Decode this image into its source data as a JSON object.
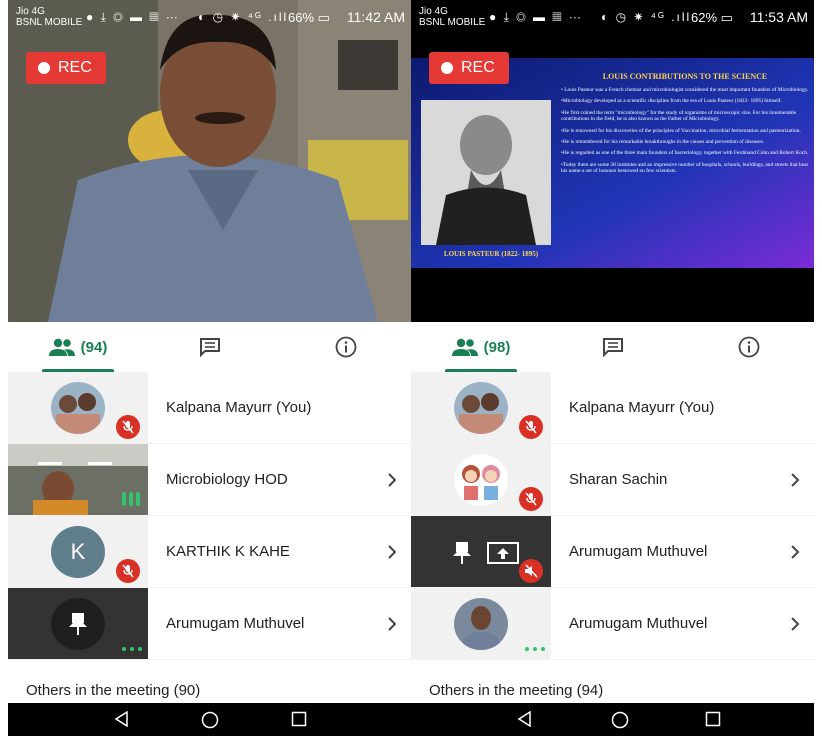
{
  "screens": [
    {
      "status_bar": {
        "carrier_line1": "Jio 4G",
        "carrier_line2": "BSNL MOBILE",
        "battery": "66%",
        "time": "11:42 AM"
      },
      "rec_label": "REC",
      "tabs": {
        "participants_count": "(94)"
      },
      "participants": [
        {
          "name": "Kalpana Mayurr (You)"
        },
        {
          "name": "Microbiology HOD"
        },
        {
          "name": "KARTHIK K KAHE",
          "avatar_initial": "K"
        },
        {
          "name": "Arumugam Muthuvel"
        }
      ],
      "others_label": "Others in the meeting (90)"
    },
    {
      "status_bar": {
        "carrier_line1": "Jio 4G",
        "carrier_line2": "BSNL MOBILE",
        "battery": "62%",
        "time": "11:53 AM"
      },
      "rec_label": "REC",
      "slide": {
        "title": "LOUIS CONTRIBUTIONS TO THE SCIENCE",
        "caption": "LOUIS PASTEUR (1822- 1895)",
        "bullets": [
          "• Louis Pasteur was a French chemist and microbiologist considered the most important founders of Microbiology.",
          "•Microbiology developed as a scientific discipline from the era of Louis Pasteur (1822- 1895) himself.",
          "•He first coined the term \"microbiology\" for the study of organisms of microscopic size. For his innumerable contributions in the field, he is also known as the Father of Microbiology.",
          "•He is renowned for his discoveries of the principles of Vaccination, microbial fermentation and pasteurization.",
          "•He is remembered for his remarkable breakthroughs in the causes and prevention of diseases.",
          "•He is regarded as one of the three main founders of bacteriology, together with Ferdinand Cohn and Robert Koch.",
          "•Today there are some 30 institutes and an impressive number of hospitals, schools, buildings, and streets that bear his name-a set of honours bestowed on few scientists."
        ]
      },
      "tabs": {
        "participants_count": "(98)"
      },
      "participants": [
        {
          "name": "Kalpana Mayurr (You)"
        },
        {
          "name": "Sharan Sachin"
        },
        {
          "name": "Arumugam Muthuvel"
        },
        {
          "name": "Arumugam Muthuvel"
        }
      ],
      "others_label": "Others in the meeting (94)"
    }
  ],
  "colors": {
    "accent_green": "#1a7f52",
    "rec_red": "#e53935",
    "mute_red": "#d93025",
    "speaking_green": "#34c36a"
  }
}
